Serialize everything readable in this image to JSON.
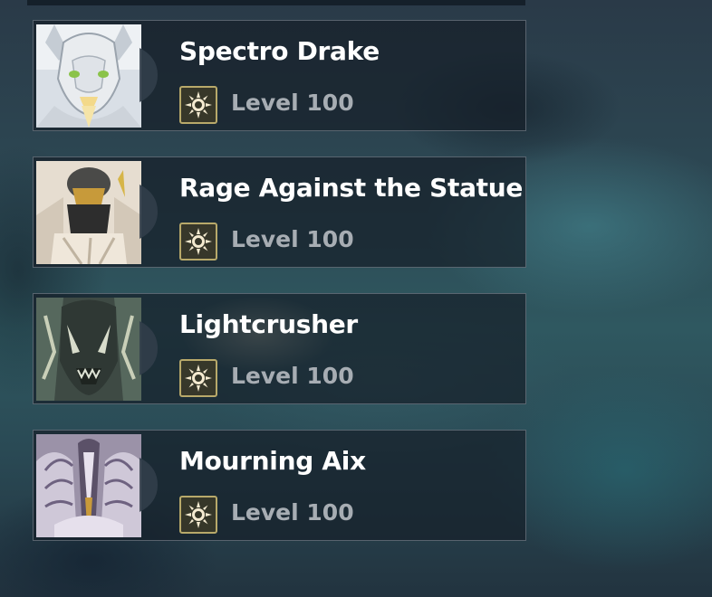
{
  "enemies": [
    {
      "name": "Spectro Drake",
      "level": "Level 100",
      "portrait_icon": "spectro-drake-portrait",
      "element_icon": "spectro-element-icon"
    },
    {
      "name": "Rage Against the Statue",
      "level": "Level 100",
      "portrait_icon": "statue-portrait",
      "element_icon": "spectro-element-icon"
    },
    {
      "name": "Lightcrusher",
      "level": "Level 100",
      "portrait_icon": "lightcrusher-portrait",
      "element_icon": "spectro-element-icon"
    },
    {
      "name": "Mourning Aix",
      "level": "Level 100",
      "portrait_icon": "mourning-aix-portrait",
      "element_icon": "spectro-element-icon"
    }
  ],
  "colors": {
    "badge_border": "#b8a96a",
    "level_text": "#a7adb3",
    "name_text": "#ffffff",
    "card_border": "#8c96a0"
  }
}
